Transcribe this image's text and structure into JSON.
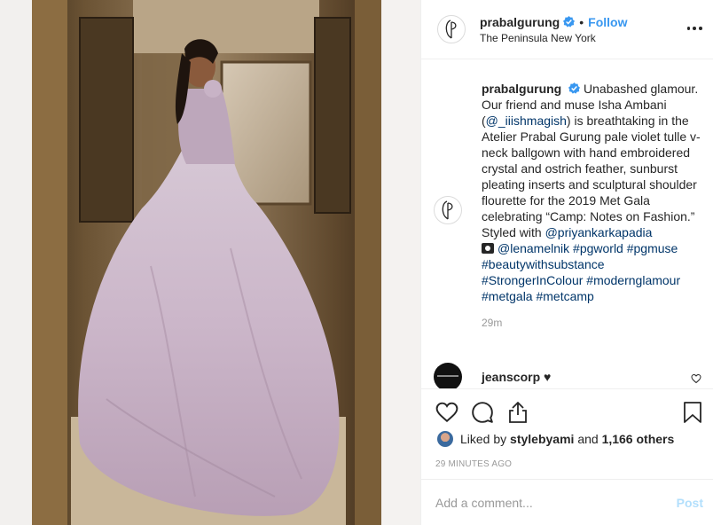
{
  "header": {
    "username": "prabalgurung",
    "separator": "•",
    "follow_label": "Follow",
    "location": "The Peninsula New York"
  },
  "caption": {
    "username": "prabalgurung",
    "text_1": "Unabashed glamour. Our friend and muse Isha Ambani (",
    "mention_1": "@_iiishmagish",
    "text_2": ") is breathtaking in the Atelier Prabal Gurung pale violet tulle v-neck ballgown with hand embroidered crystal and ostrich feather, sunburst pleating inserts and sculptural shoulder flourette for the 2019 Met Gala celebrating “Camp: Notes on Fashion.” Styled with ",
    "mention_2": "@priyankarkapadia",
    "mention_3": "@lenamelnik",
    "tags": "#pgworld #pgmuse #beautywithsubstance #StrongerInColour #modernglamour #metgala #metcamp",
    "time": "29m"
  },
  "comment": {
    "username": "jeanscorp",
    "text": "♥"
  },
  "likes": {
    "prefix": "Liked by",
    "user": "stylebyami",
    "and": "and",
    "count": "1,166 others"
  },
  "timestamp": "29 MINUTES AGO",
  "add_comment": {
    "placeholder": "Add a comment...",
    "post_label": "Post"
  },
  "colors": {
    "accent": "#3897f0",
    "post_disabled": "#b2dffc",
    "link": "#003569",
    "muted": "#999999"
  }
}
